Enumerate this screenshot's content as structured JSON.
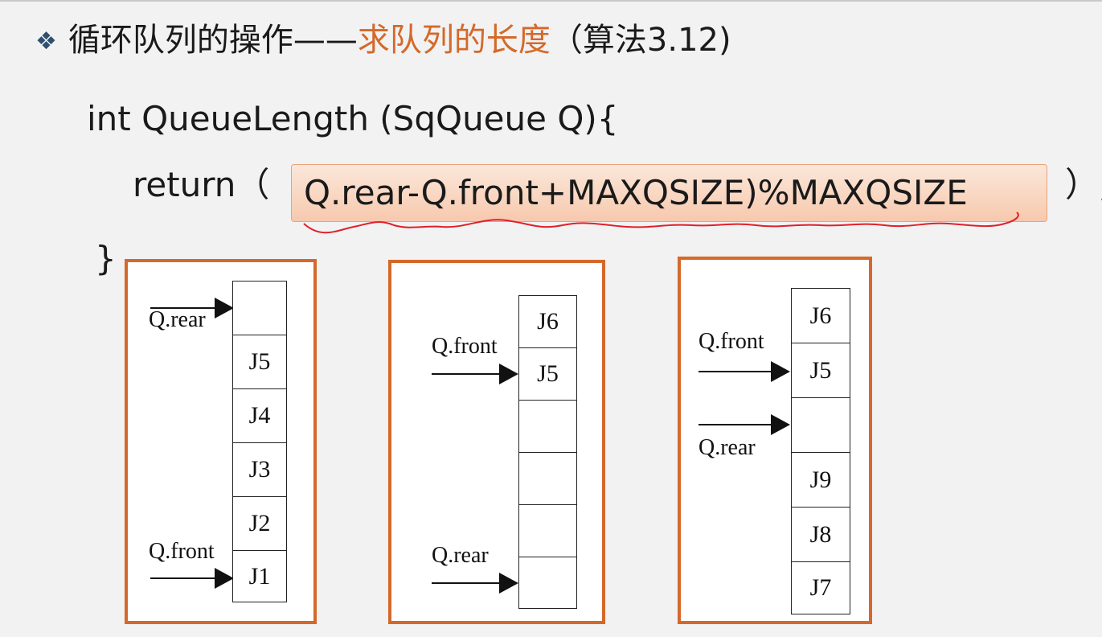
{
  "title": {
    "bullet": "❖",
    "prefix": "循环队列的操作——",
    "highlight": "求队列的长度",
    "suffix": "（算法3.12)"
  },
  "code": {
    "line1": "int  QueueLength (SqQueue Q){",
    "line2_prefix": "return（",
    "answer": "Q.rear-Q.front+MAXQSIZE)%MAXQSIZE",
    "line2_suffix": "）;",
    "closing": "}"
  },
  "colors": {
    "accent": "#d4692a",
    "answer_fill": "#f7c9ae",
    "underline": "#e0202a",
    "bullet": "#2f4f6f"
  },
  "diagrams": [
    {
      "cells": [
        "",
        "J5",
        "J4",
        "J3",
        "J2",
        "J1"
      ],
      "labels": {
        "rear": "Q.rear",
        "front": "Q.front"
      }
    },
    {
      "cells": [
        "J6",
        "J5",
        "",
        "",
        "",
        ""
      ],
      "labels": {
        "front": "Q.front",
        "rear": "Q.rear"
      }
    },
    {
      "cells": [
        "J6",
        "J5",
        "",
        "J9",
        "J8",
        "J7"
      ],
      "labels": {
        "front": "Q.front",
        "rear": "Q.rear"
      }
    }
  ]
}
